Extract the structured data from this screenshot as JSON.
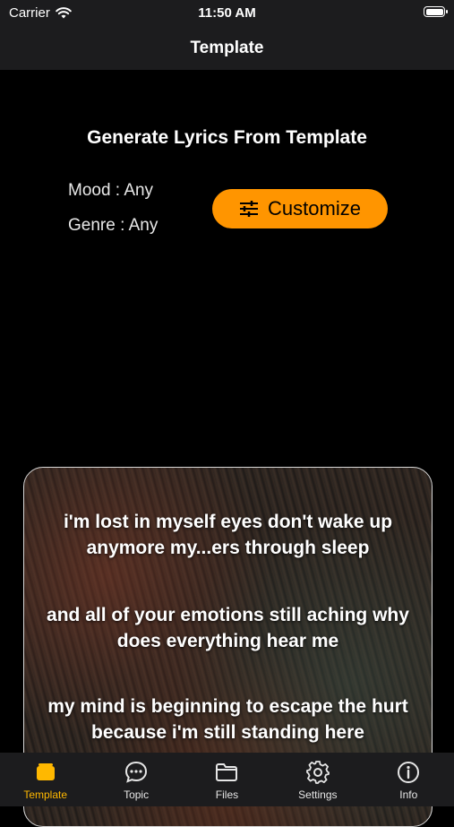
{
  "status_bar": {
    "carrier": "Carrier",
    "time": "11:50 AM",
    "icons": [
      "wifi-icon",
      "battery-icon"
    ]
  },
  "nav": {
    "title": "Template"
  },
  "main": {
    "heading": "Generate Lyrics From Template",
    "mood": "Mood : Any",
    "genre": "Genre : Any",
    "customize_button": {
      "label": "Customize",
      "icon": "sliders-icon",
      "color": "#ff9500"
    }
  },
  "lyrics": [
    "i'm lost in myself eyes don't wake up anymore my...ers through sleep",
    "and all of your emotions still aching why does everything hear me",
    "my mind is beginning to escape the hurt because i'm still standing here"
  ],
  "tabs": [
    {
      "label": "Template",
      "icon": "template-icon",
      "active": true
    },
    {
      "label": "Topic",
      "icon": "chat-bubble-icon",
      "active": false
    },
    {
      "label": "Files",
      "icon": "folder-icon",
      "active": false
    },
    {
      "label": "Settings",
      "icon": "gear-icon",
      "active": false
    },
    {
      "label": "Info",
      "icon": "info-icon",
      "active": false
    }
  ],
  "colors": {
    "accent": "#ff9500",
    "tab_active": "#ffb800",
    "bar_background": "#1c1c1e"
  }
}
